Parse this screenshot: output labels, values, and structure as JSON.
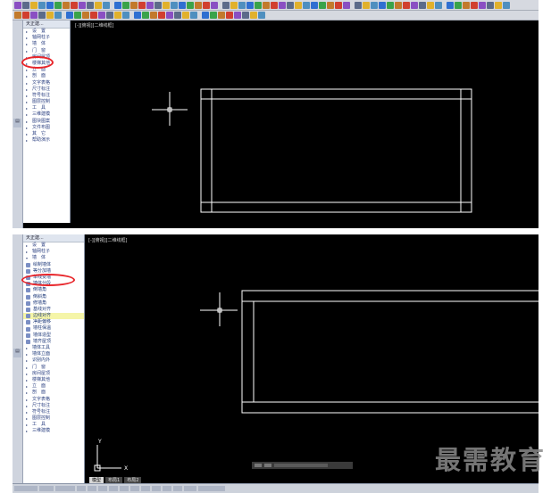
{
  "colors": {
    "canvas_bg": "#000000",
    "line_white": "#ffffff",
    "highlight_circle": "#e8262b",
    "menu_text": "#2a3f80",
    "toolbar_bg": "#d6d9e0",
    "watermark": "#8a8a8a"
  },
  "top_screenshot": {
    "sidebar": {
      "title": "天正建...",
      "items": [
        {
          "label": "设　置",
          "icon": "arrow-right-icon"
        },
        {
          "label": "轴网柱子",
          "icon": "arrow-right-icon"
        },
        {
          "label": "墙　体",
          "icon": "arrow-right-icon",
          "circled": true
        },
        {
          "label": "门　窗",
          "icon": "arrow-right-icon"
        },
        {
          "label": "房间屋顶",
          "icon": "arrow-right-icon"
        },
        {
          "label": "楼梯其他",
          "icon": "arrow-right-icon"
        },
        {
          "label": "立　面",
          "icon": "arrow-right-icon"
        },
        {
          "label": "剖　面",
          "icon": "arrow-right-icon"
        },
        {
          "label": "文字表格",
          "icon": "arrow-right-icon"
        },
        {
          "label": "尺寸标注",
          "icon": "arrow-right-icon"
        },
        {
          "label": "符号标注",
          "icon": "arrow-right-icon"
        },
        {
          "label": "图层控制",
          "icon": "arrow-right-icon"
        },
        {
          "label": "工　具",
          "icon": "arrow-right-icon"
        },
        {
          "label": "三维建模",
          "icon": "arrow-right-icon"
        },
        {
          "label": "图块图案",
          "icon": "arrow-right-icon"
        },
        {
          "label": "文件布图",
          "icon": "arrow-right-icon"
        },
        {
          "label": "其　它",
          "icon": "arrow-right-icon"
        },
        {
          "label": "帮助演示",
          "icon": "arrow-right-icon"
        }
      ]
    },
    "drawing_tab": "[-][俯视][二维线框]"
  },
  "bottom_screenshot": {
    "sidebar": {
      "title": "天正建...",
      "items_top": [
        {
          "label": "设　置",
          "icon": "arrow-right-icon"
        },
        {
          "label": "轴网柱子",
          "icon": "arrow-right-icon"
        },
        {
          "label": "墙　体",
          "icon": "arrow-down-icon"
        }
      ],
      "wall_submenu": [
        {
          "label": "绘制墙体",
          "icon": "wall-draw-icon",
          "circled": true
        },
        {
          "label": "等分加墙",
          "icon": "wall-icon"
        },
        {
          "label": "单线变墙",
          "icon": "wall-icon"
        },
        {
          "label": "墙体分段",
          "icon": "wall-icon"
        },
        {
          "label": "倒墙角",
          "icon": "wall-icon"
        },
        {
          "label": "倒斜角",
          "icon": "wall-icon"
        },
        {
          "label": "修墙角",
          "icon": "wall-icon"
        },
        {
          "label": "基线对齐",
          "icon": "wall-icon"
        },
        {
          "label": "边线对齐",
          "icon": "wall-icon",
          "highlighted": true
        },
        {
          "label": "净距偏移",
          "icon": "wall-icon"
        },
        {
          "label": "墙柱保温",
          "icon": "wall-icon"
        },
        {
          "label": "墙体造型",
          "icon": "wall-icon"
        },
        {
          "label": "墙齐屋顶",
          "icon": "wall-icon"
        },
        {
          "label": "墙体工具",
          "icon": "arrow-right-icon"
        },
        {
          "label": "墙体立面",
          "icon": "arrow-right-icon"
        },
        {
          "label": "识别内外",
          "icon": "arrow-right-icon"
        }
      ],
      "items_bottom": [
        {
          "label": "门　窗",
          "icon": "arrow-right-icon"
        },
        {
          "label": "房间屋顶",
          "icon": "arrow-right-icon"
        },
        {
          "label": "楼梯其他",
          "icon": "arrow-right-icon"
        },
        {
          "label": "立　面",
          "icon": "arrow-right-icon"
        },
        {
          "label": "剖　面",
          "icon": "arrow-right-icon"
        },
        {
          "label": "文字表格",
          "icon": "arrow-right-icon"
        },
        {
          "label": "尺寸标注",
          "icon": "arrow-right-icon"
        },
        {
          "label": "符号标注",
          "icon": "arrow-right-icon"
        },
        {
          "label": "图层控制",
          "icon": "arrow-right-icon"
        },
        {
          "label": "工　具",
          "icon": "arrow-right-icon"
        },
        {
          "label": "三维建模",
          "icon": "arrow-right-icon"
        }
      ]
    },
    "drawing_tab": "[-][俯视][二维线框]",
    "ucs_labels": {
      "y": "Y",
      "x": "X"
    },
    "layout_tabs": [
      "模型",
      "布局1",
      "布局2"
    ]
  },
  "watermark": "最需教育"
}
